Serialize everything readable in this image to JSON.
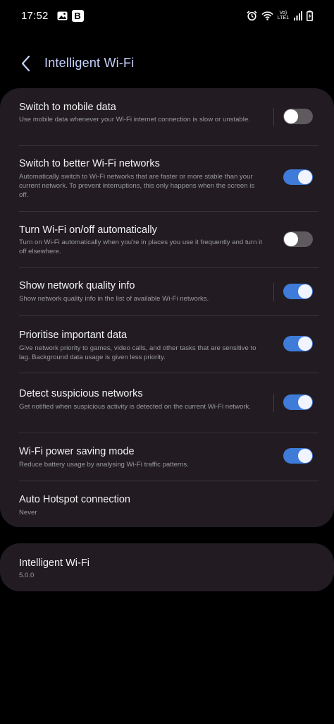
{
  "status_bar": {
    "time": "17:52",
    "b_badge": "B",
    "volte_top": "Vo)",
    "volte_bottom": "LTE1"
  },
  "header": {
    "title": "Intelligent Wi-Fi"
  },
  "settings": [
    {
      "title": "Switch to mobile data",
      "desc": "Use mobile data whenever your Wi-Fi internet connection is slow or unstable.",
      "toggle": "off"
    },
    {
      "title": "Switch to better Wi-Fi networks",
      "desc": "Automatically switch to Wi-Fi networks that are faster or more stable than your current network. To prevent interruptions, this only happens when the screen is off.",
      "toggle": "on"
    },
    {
      "title": "Turn Wi-Fi on/off automatically",
      "desc": "Turn on Wi-Fi automatically when you're in places you use it frequently and turn it off elsewhere.",
      "toggle": "off"
    },
    {
      "title": "Show network quality info",
      "desc": "Show network quality info in the list of available Wi-Fi networks.",
      "toggle": "on"
    },
    {
      "title": "Prioritise important data",
      "desc": "Give network priority to games, video calls, and other tasks that are sensitive to lag. Background data usage is given less priority.",
      "toggle": "on"
    },
    {
      "title": "Detect suspicious networks",
      "desc": "Get notified when suspicious activity is detected on the current Wi-Fi network.",
      "toggle": "on"
    },
    {
      "title": "Wi-Fi power saving mode",
      "desc": "Reduce battery usage by analysing Wi-Fi traffic patterns.",
      "toggle": "on"
    },
    {
      "title": "Auto Hotspot connection",
      "desc": "Never"
    }
  ],
  "about": {
    "title": "Intelligent Wi-Fi",
    "version": "5.0.0"
  },
  "colors": {
    "background": "#000000",
    "card": "#221c22",
    "title_accent": "#c7d3ff",
    "toggle_on": "#3f7bd9",
    "toggle_off": "#5e5a5e"
  }
}
